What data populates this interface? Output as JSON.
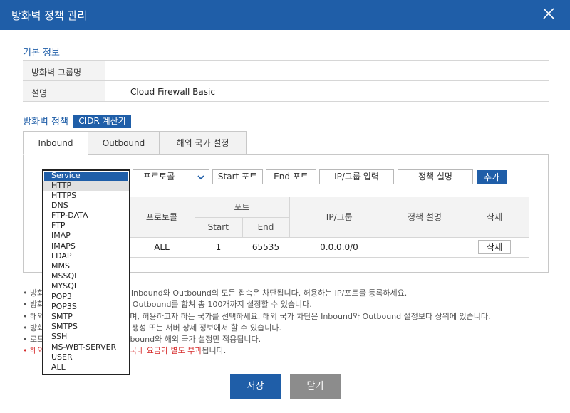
{
  "window": {
    "title": "방화벽 정책 관리"
  },
  "basic": {
    "section_title": "기본 정보",
    "group_name_label": "방화벽 그룹명",
    "group_name_value": "",
    "description_label": "설명",
    "description_value": "Cloud Firewall Basic"
  },
  "policy": {
    "section_title": "방화벽 정책",
    "cidr_button": "CIDR 계산기",
    "tabs": [
      "Inbound",
      "Outbound",
      "해외 국가 설정"
    ],
    "active_tab": 0,
    "form": {
      "protocol_select": "프로토콜",
      "start_port_placeholder": "Start 포트",
      "end_port_placeholder": "End 포트",
      "ip_placeholder": "IP/그룹 입력",
      "desc_placeholder": "정책 설명",
      "add_button": "추가"
    },
    "table": {
      "col_protocol": "프로토콜",
      "col_port": "포트",
      "col_start": "Start",
      "col_end": "End",
      "col_ip": "IP/그룹",
      "col_desc": "정책 설명",
      "col_delete": "삭제",
      "row": {
        "protocol": "ALL",
        "start": "1",
        "end": "65535",
        "ip": "0.0.0.0/0",
        "desc": "",
        "delete_button": "삭제"
      }
    }
  },
  "service_dropdown": {
    "selected": "Service",
    "options": [
      "Service",
      "HTTP",
      "HTTPS",
      "DNS",
      "FTP-DATA",
      "FTP",
      "IMAP",
      "IMAPS",
      "LDAP",
      "MMS",
      "MSSQL",
      "MYSQL",
      "POP3",
      "POP3S",
      "SMTP",
      "SMTPS",
      "SSH",
      "MS-WBT-SERVER",
      "USER",
      "ALL"
    ]
  },
  "notes": {
    "n1": "• 방화",
    "n1b": "면 Inbound와 Outbound의 모든 접속은 차단됩니다. 허용하는 IP/포트를 등록하세요.",
    "n2": "• 방화",
    "n2b": "와 Outbound를 합쳐 총 100개까지 설정할 수 있습니다.",
    "n3": "• 해외",
    "n3b": "이며, 허용하고자 하는 국가를 선택하세요. 해외 국가 차단은 Inbound와 Outbound 설정보다 상위에 있습니다.",
    "n4": "• 방화",
    "n4b": "버 생성 또는 서버 상세 정보에서 할 수 있습니다.",
    "n5": "• 로드",
    "n5b": "Inbound와 해외 국가 설정만 적용됩니다.",
    "n6": "• 해외",
    "n6b_red": "은 국내 요금과 별도 부과",
    "n6c": "됩니다."
  },
  "footer": {
    "save_button": "저장",
    "close_button": "닫기"
  },
  "colors": {
    "primary": "#1f5ea8",
    "gray_button": "#8c8c8c",
    "warning": "#d62b2b"
  }
}
